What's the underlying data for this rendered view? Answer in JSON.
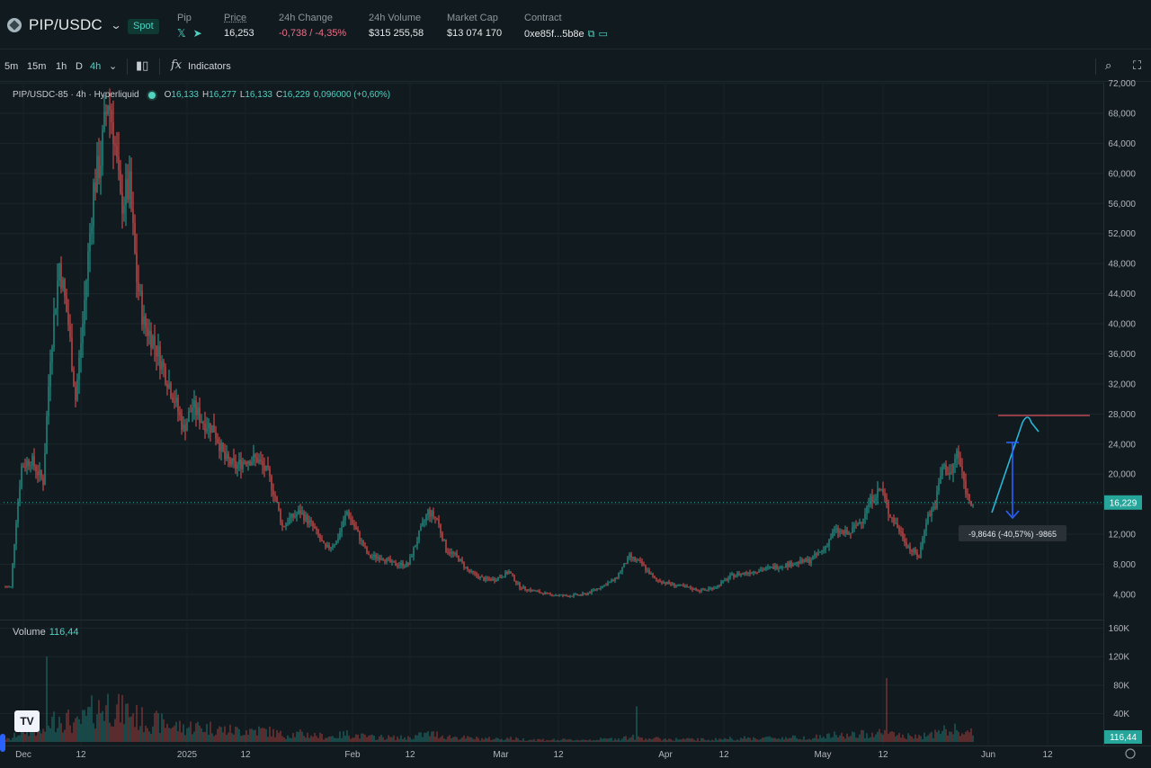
{
  "header": {
    "pair": "PIP/USDC",
    "market_type": "Spot",
    "stats": [
      {
        "label": "Pip",
        "value": ""
      },
      {
        "label": "Price",
        "value": "16,253"
      },
      {
        "label": "24h Change",
        "value": "-0,738 / -4,35%"
      },
      {
        "label": "24h Volume",
        "value": "$315 255,58"
      },
      {
        "label": "Market Cap",
        "value": "$13 074 170"
      },
      {
        "label": "Contract",
        "value": "0xe85f...5b8e"
      }
    ]
  },
  "toolbar": {
    "timeframes": [
      "5m",
      "15m",
      "1h",
      "D",
      "4h"
    ],
    "active_timeframe": "4h",
    "indicators_label": "Indicators"
  },
  "legend": {
    "symbol": "PIP/USDC-85 · 4h · Hyperliquid",
    "o_label": "O",
    "o": "16,133",
    "h_label": "H",
    "h": "16,277",
    "l_label": "L",
    "l": "16,133",
    "c_label": "C",
    "c": "16,229",
    "change": "0,096000 (+0,60%)"
  },
  "volume": {
    "label": "Volume",
    "value": "116,44",
    "last_label": "116,44"
  },
  "price_axis": [
    "72,000",
    "68,000",
    "64,000",
    "60,000",
    "56,000",
    "52,000",
    "48,000",
    "44,000",
    "40,000",
    "36,000",
    "32,000",
    "28,000",
    "24,000",
    "20,000",
    "16,000",
    "12,000",
    "8,000",
    "4,000"
  ],
  "volume_axis": [
    "160K",
    "120K",
    "80K",
    "40K"
  ],
  "time_axis": [
    "Dec",
    "12",
    "2025",
    "12",
    "Feb",
    "12",
    "Mar",
    "12",
    "Apr",
    "12",
    "May",
    "12",
    "Jun",
    "12"
  ],
  "last_price_label": "16,229",
  "measure_label": "-9,8646 (-40,57%) -9865",
  "colors": {
    "up": "#26a69a",
    "down": "#ef5350",
    "accent": "#50d2c1",
    "background": "#111a1f",
    "measure": "#2962ff",
    "drawing": "#29b6d6",
    "hline": "#e05260"
  }
}
